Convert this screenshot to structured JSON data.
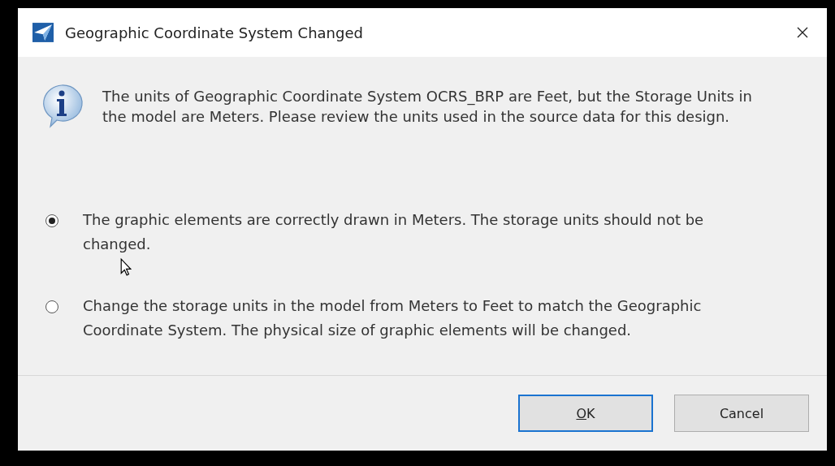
{
  "dialog": {
    "title": "Geographic Coordinate System Changed",
    "message": "The units of Geographic Coordinate System OCRS_BRP are Feet, but the Storage Units in the model are Meters. Please review the units used in the source data for this design.",
    "options": [
      {
        "label": "The graphic elements are correctly drawn in Meters. The storage units should not be changed.",
        "selected": true
      },
      {
        "label": "Change the storage units in the model from Meters to Feet to match the Geographic Coordinate System. The physical size of graphic elements will be changed.",
        "selected": false
      }
    ],
    "buttons": [
      {
        "label": "OK",
        "default": true,
        "access_key": true
      },
      {
        "label": "Cancel",
        "default": false,
        "access_key": false
      }
    ]
  }
}
